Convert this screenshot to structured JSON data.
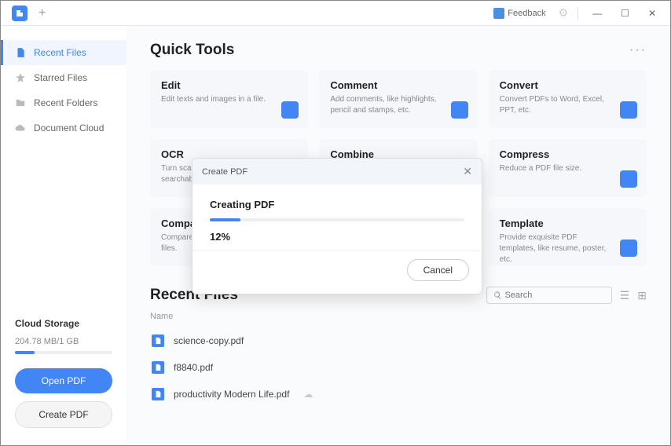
{
  "titlebar": {
    "feedback": "Feedback"
  },
  "sidebar": {
    "items": [
      {
        "label": "Recent Files"
      },
      {
        "label": "Starred Files"
      },
      {
        "label": "Recent Folders"
      },
      {
        "label": "Document Cloud"
      }
    ],
    "storage_title": "Cloud Storage",
    "storage_text": "204.78 MB/1 GB",
    "open_label": "Open PDF",
    "create_label": "Create PDF"
  },
  "quick": {
    "title": "Quick Tools",
    "tools": [
      {
        "title": "Edit",
        "desc": "Edit texts and images in a file."
      },
      {
        "title": "Comment",
        "desc": "Add comments, like highlights, pencil and stamps, etc."
      },
      {
        "title": "Convert",
        "desc": "Convert PDFs to Word, Excel, PPT, etc."
      },
      {
        "title": "OCR",
        "desc": "Turn scanned PDFs into searchable documents."
      },
      {
        "title": "Combine",
        "desc": ""
      },
      {
        "title": "Compress",
        "desc": "Reduce a PDF file size."
      },
      {
        "title": "Compare",
        "desc": "Compare different versions of files."
      },
      {
        "title": "",
        "desc": ""
      },
      {
        "title": "Template",
        "desc": "Provide exquisite PDF templates, like resume, poster, etc."
      }
    ]
  },
  "recent": {
    "title": "Recent Files",
    "search_placeholder": "Search",
    "col_name": "Name",
    "files": [
      {
        "name": "science-copy.pdf"
      },
      {
        "name": "f8840.pdf"
      },
      {
        "name": "productivity Modern Life.pdf"
      }
    ]
  },
  "modal": {
    "title": "Create PDF",
    "progress_title": "Creating PDF",
    "percent_label": "12%",
    "percent_val": 12,
    "cancel": "Cancel"
  }
}
